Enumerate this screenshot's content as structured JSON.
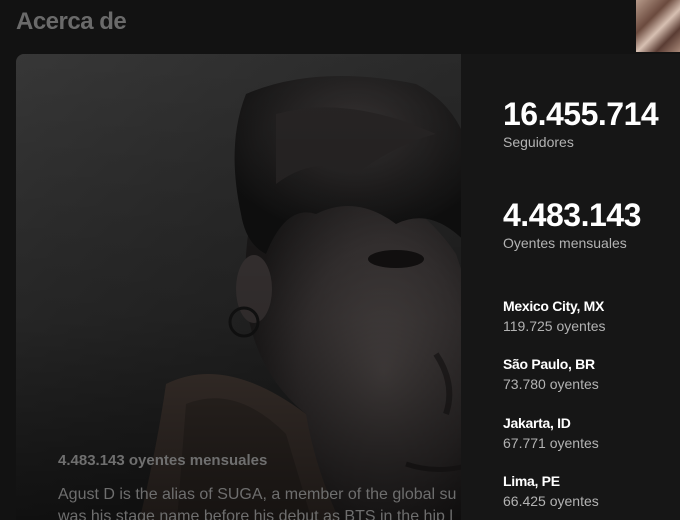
{
  "about": {
    "title": "Acerca de",
    "monthly_listeners_text": "4.483.143 oyentes mensuales",
    "bio_lines": [
      "Agust D is the alias of SUGA, a member of the global su",
      "was his stage name before his debut as BTS in the hip l"
    ]
  },
  "stats": {
    "followers": {
      "value": "16.455.714",
      "label": "Seguidores"
    },
    "monthly_listeners": {
      "value": "4.483.143",
      "label": "Oyentes mensuales"
    }
  },
  "cities": [
    {
      "name": "Mexico City, MX",
      "listeners": "119.725 oyentes"
    },
    {
      "name": "São Paulo, BR",
      "listeners": "73.780 oyentes"
    },
    {
      "name": "Jakarta, ID",
      "listeners": "67.771 oyentes"
    },
    {
      "name": "Lima, PE",
      "listeners": "66.425 oyentes"
    }
  ],
  "colors": {
    "background": "#121212",
    "panel": "#161616",
    "primary_text": "#ffffff",
    "secondary_text": "#b3b3b3"
  }
}
